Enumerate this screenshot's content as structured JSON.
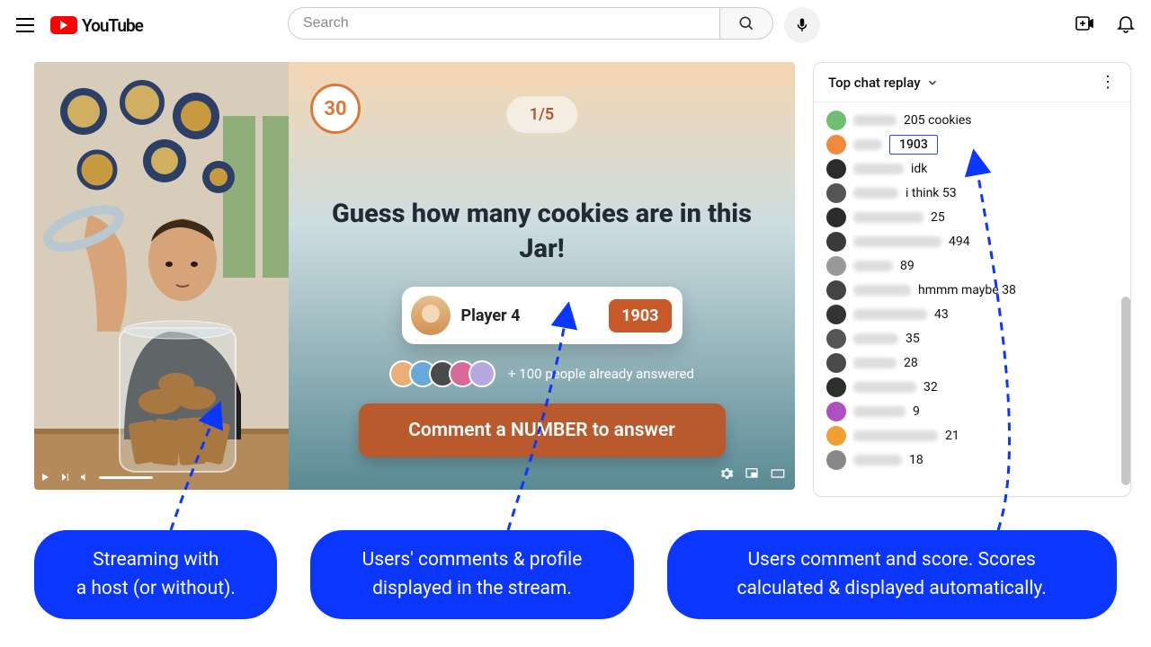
{
  "header": {
    "logo_text": "YouTube",
    "search_placeholder": "Search"
  },
  "game": {
    "timer": "30",
    "progress": "1/5",
    "question": "Guess how many cookies are in this Jar!",
    "featured_player": "Player 4",
    "featured_value": "1903",
    "already_answered": "+ 100 people already answered",
    "cta": "Comment a NUMBER to answer"
  },
  "chat": {
    "title": "Top chat replay",
    "highlight_index": 1,
    "messages": [
      {
        "avatar_color": "#6fbf73",
        "name_w": 48,
        "msg": "205 cookies"
      },
      {
        "avatar_color": "#f08a3c",
        "name_w": 32,
        "msg": "1903"
      },
      {
        "avatar_color": "#2b2b2b",
        "name_w": 56,
        "msg": "idk"
      },
      {
        "avatar_color": "#555555",
        "name_w": 50,
        "msg": "i think 53"
      },
      {
        "avatar_color": "#2b2b2b",
        "name_w": 78,
        "msg": "25"
      },
      {
        "avatar_color": "#3a3a3a",
        "name_w": 98,
        "msg": "494"
      },
      {
        "avatar_color": "#999999",
        "name_w": 44,
        "msg": "89"
      },
      {
        "avatar_color": "#444444",
        "name_w": 64,
        "msg": "hmmm maybe 38"
      },
      {
        "avatar_color": "#333333",
        "name_w": 82,
        "msg": "43"
      },
      {
        "avatar_color": "#555555",
        "name_w": 50,
        "msg": "35"
      },
      {
        "avatar_color": "#4a4a4a",
        "name_w": 48,
        "msg": "28"
      },
      {
        "avatar_color": "#2e2e2e",
        "name_w": 70,
        "msg": "32"
      },
      {
        "avatar_color": "#b050c0",
        "name_w": 58,
        "msg": "9"
      },
      {
        "avatar_color": "#f0a030",
        "name_w": 94,
        "msg": "21"
      },
      {
        "avatar_color": "#888888",
        "name_w": 54,
        "msg": "18"
      }
    ]
  },
  "callouts": {
    "left": "Streaming with\na host (or without).",
    "center": "Users' comments & profile\ndisplayed in the stream.",
    "right": "Users comment and score. Scores\ncalculated & displayed automatically."
  },
  "avatar_stack_colors": [
    "#e8b078",
    "#6aa8d8",
    "#4a4a4a",
    "#d86a9a",
    "#b8a8e0"
  ]
}
